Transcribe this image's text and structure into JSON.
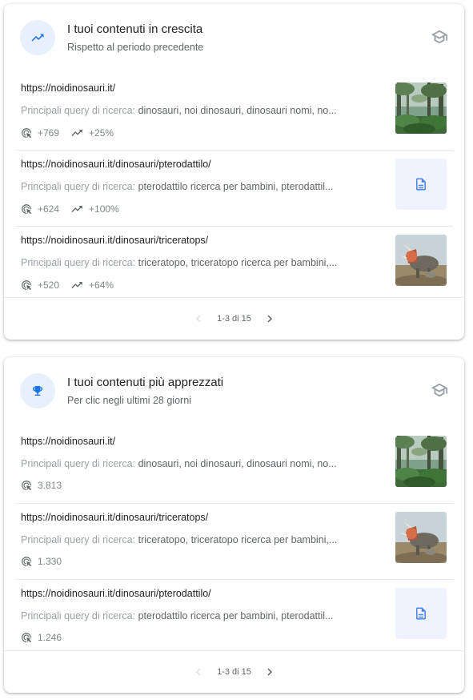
{
  "growing": {
    "title": "I tuoi contenuti in crescita",
    "subtitle": "Rispetto al periodo precedente",
    "header_icon": "trending-up-icon",
    "cap_icon": "school-icon",
    "rows": [
      {
        "url": "https://noidinosauri.it/",
        "query_label": "Principali query di ricerca: ",
        "query_value": "dinosauri, noi dinosauri, dinosauri nomi, no...",
        "clicks": "+769",
        "trend": "+25%",
        "thumb": "forest-image"
      },
      {
        "url": "https://noidinosauri.it/dinosauri/pterodattilo/",
        "query_label": "Principali query di ricerca: ",
        "query_value": "pterodattilo ricerca per bambini, pterodattil...",
        "clicks": "+624",
        "trend": "+100%",
        "thumb": "document-icon"
      },
      {
        "url": "https://noidinosauri.it/dinosauri/triceratops/",
        "query_label": "Principali query di ricerca: ",
        "query_value": "triceratopo, triceratopo ricerca per bambini,...",
        "clicks": "+520",
        "trend": "+64%",
        "thumb": "triceratops-image"
      }
    ],
    "pagination": "1-3 di 15"
  },
  "popular": {
    "title": "I tuoi contenuti più apprezzati",
    "subtitle": "Per clic negli ultimi 28 giorni",
    "header_icon": "trophy-icon",
    "cap_icon": "school-icon",
    "rows": [
      {
        "url": "https://noidinosauri.it/",
        "query_label": "Principali query di ricerca: ",
        "query_value": "dinosauri, noi dinosauri, dinosauri nomi, no...",
        "clicks": "3.813",
        "thumb": "forest-image"
      },
      {
        "url": "https://noidinosauri.it/dinosauri/triceratops/",
        "query_label": "Principali query di ricerca: ",
        "query_value": "triceratopo, triceratopo ricerca per bambini,...",
        "clicks": "1.330",
        "thumb": "triceratops-image"
      },
      {
        "url": "https://noidinosauri.it/dinosauri/pterodattilo/",
        "query_label": "Principali query di ricerca: ",
        "query_value": "pterodattilo ricerca per bambini, pterodattil...",
        "clicks": "1.246",
        "thumb": "document-icon"
      }
    ],
    "pagination": "1-3 di 15"
  },
  "colors": {
    "accent": "#1a73e8",
    "icon_bg": "#e8f0fe",
    "text_primary": "#202124",
    "text_secondary": "#5f6368",
    "text_muted": "#9aa0a6",
    "divider": "#e8eaed"
  }
}
